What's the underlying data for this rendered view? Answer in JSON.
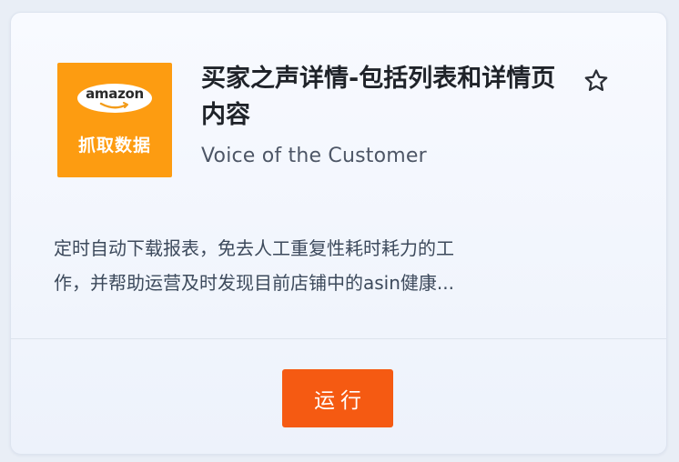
{
  "card": {
    "logo": {
      "brand_text": "amazon",
      "sub_text": "抓取数据",
      "bg_color": "#fd9c11"
    },
    "title": "买家之声详情-包括列表和详情页内容",
    "star_icon": "star-outline-icon",
    "subtitle": "Voice of the Customer",
    "description_lines": [
      "定时自动下载报表，免去人工重复性耗时耗力的工",
      "作，并帮助运营及时发现目前店铺中的asin健康..."
    ],
    "run_button": {
      "label": "运行",
      "color": "#f55a12"
    }
  }
}
